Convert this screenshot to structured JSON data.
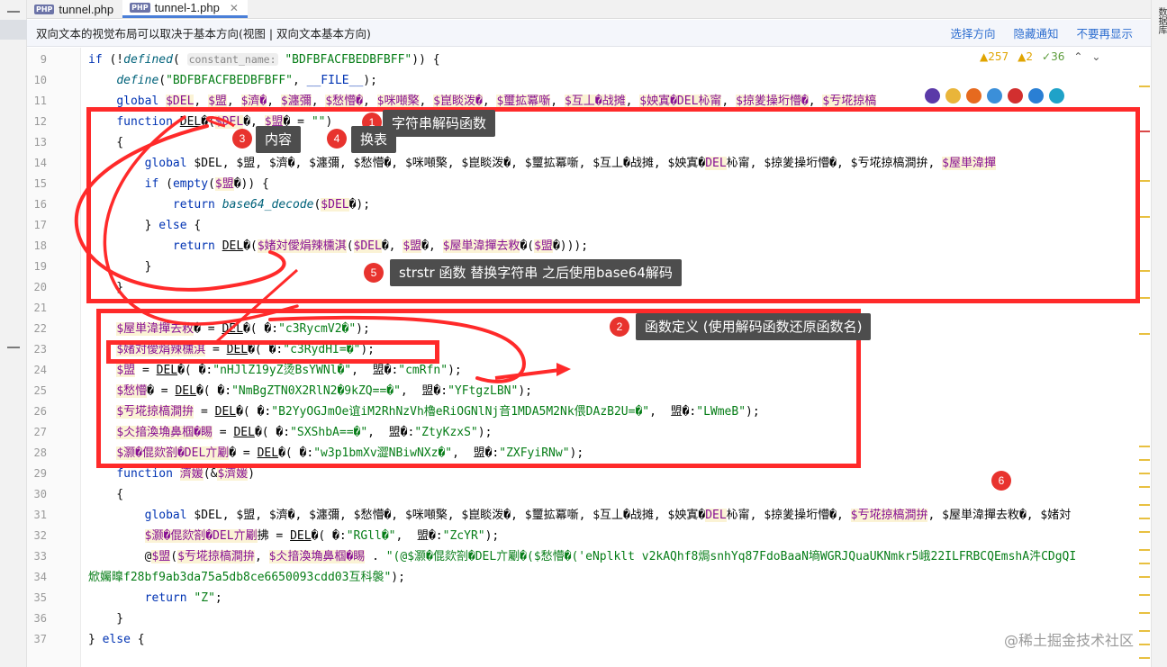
{
  "tabs": [
    {
      "label": "tunnel.php",
      "active": false,
      "icon": "php-file-icon"
    },
    {
      "label": "tunnel-1.php",
      "active": true,
      "icon": "php-file-icon"
    }
  ],
  "banner": {
    "message": "双向文本的视觉布局可以取决于基本方向(视图 | 双向文本基本方向)",
    "actions": [
      "选择方向",
      "隐藏通知",
      "不要再显示"
    ]
  },
  "right_tool": "数据库",
  "inspections": {
    "warnings": "▲257",
    "weak": "▲2",
    "ok": "✓36"
  },
  "code_lines": [
    {
      "n": "9",
      "html": "<span class=\"kw\">if</span> (!<span class=\"fn\">defined</span>( <span class=\"hint\">constant_name:</span> <span class=\"st\">\"BDFBFACFBEDBFBFF\"</span>)) {"
    },
    {
      "n": "10",
      "html": "    <span class=\"fn\">define</span>(<span class=\"st\">\"BDFBFACFBEDBFBFF\"</span>, <span class=\"kw\">__FILE__</span>);"
    },
    {
      "n": "11",
      "html": "    <span class=\"kw\">global</span> <span class=\"var\">$DEL</span>, <span class=\"var\">$盟</span>, <span class=\"var\">$濟�</span>, <span class=\"var\">$瀍彌</span>, <span class=\"var\">$愁懵�</span>, <span class=\"var\">$咪噸檠</span>, <span class=\"var\">$崑睒泼�</span>, <span class=\"var\">$璽拡冪噺</span>, <span class=\"var\">$互丄�战摊</span>, <span class=\"var\">$姎寘�DEL杺甯</span>, <span class=\"var\">$掠夎操垳懵�</span>, <span class=\"var\">$亐埖掠槁</span>"
    },
    {
      "n": "12",
      "html": "    <span class=\"kw\">function</span> <span class=\"ul\">DEL</span>�(<span class=\"var\">$DEL</span>�, <span class=\"var\">$盟</span>� = <span class=\"st\">\"\"</span>)"
    },
    {
      "n": "13",
      "html": "    {"
    },
    {
      "n": "14",
      "html": "        <span class=\"kw\">global</span> $DEL, $盟, $濟�, $瀍彌, $愁懵�, $咪噸檠, $崑睒泼�, $璽拡冪噺, $互丄�战摊, $姎寘�<span class=\"var\">DEL</span>杺甯, $掠夎操垳懵�, $亐埖掠槁澗拚, <span class=\"var\">$屋単湋撣</span>"
    },
    {
      "n": "15",
      "html": "        <span class=\"kw\">if</span> (<span class=\"kw\">empty</span>(<span class=\"var\">$盟</span>�)) {"
    },
    {
      "n": "16",
      "html": "            <span class=\"kw\">return</span> <span class=\"fn\">base64_decode</span>(<span class=\"var\">$DEL</span>�);"
    },
    {
      "n": "17",
      "html": "        } <span class=\"kw\">else</span> {"
    },
    {
      "n": "18",
      "html": "            <span class=\"kw\">return</span> <span class=\"ul\">DEL</span>�(<span class=\"var\">$媎対僾焆辣櫄淇</span>(<span class=\"var\">$DEL</span>�, <span class=\"var\">$盟</span>�, <span class=\"var\">$屋単湋撣去敉</span>�(<span class=\"var\">$盟</span>�)));"
    },
    {
      "n": "19",
      "html": "        }"
    },
    {
      "n": "20",
      "html": "    }"
    },
    {
      "n": "21",
      "html": ""
    },
    {
      "n": "22",
      "html": "    <span class=\"var\">$屋単湋撣去敉</span>� = <span class=\"ul\">DEL</span>�( �:<span class=\"st\">\"c3RycmV2�\"</span>);"
    },
    {
      "n": "23",
      "html": "    <span class=\"var\">$媎対僾焆辣櫄淇</span> = <span class=\"ul\">DEL</span>�( �:<span class=\"st\">\"c3RydHI=�\"</span>);"
    },
    {
      "n": "24",
      "html": "    <span class=\"var\">$盟</span> = <span class=\"ul\">DEL</span>�( �:<span class=\"st\">\"nHJlZ19yZ烫BsYWNl�\"</span>,  盟�:<span class=\"st\">\"cmRfn\"</span>);"
    },
    {
      "n": "25",
      "html": "    <span class=\"var\">$愁懵</span>� = <span class=\"ul\">DEL</span>�( �:<span class=\"st\">\"NmBgZTN0X2RlN2�9kZQ==�\"</span>,  盟�:<span class=\"st\">\"YFtgzLBN\"</span>);"
    },
    {
      "n": "26",
      "html": "    <span class=\"var\">$亐埖掠槁澗拚</span> = <span class=\"ul\">DEL</span>�( �:<span class=\"st\">\"B2YyOGJmOe谊iM2RhNzVh櫓eRiOGNlNj音1MDA5M2Nk偎DAzB2U=�\"</span>,  盟�:<span class=\"st\">\"LWmeB\"</span>);"
    },
    {
      "n": "27",
      "html": "    <span class=\"var\">$仌揞渙埆鼻椢�睗</span> = <span class=\"ul\">DEL</span>�( �:<span class=\"st\">\"SXShbA==�\"</span>,  盟�:<span class=\"st\">\"ZtyKzxS\"</span>);"
    },
    {
      "n": "28",
      "html": "    <span class=\"var\">$灏�倱欻劄�DEL亣劚</span>� = <span class=\"ul\">DEL</span>�( �:<span class=\"st\">\"w3p1bmXv澀NBiwNXz�\"</span>,  盟�:<span class=\"st\">\"ZXFyiRNw\"</span>);"
    },
    {
      "n": "29",
      "html": "    <span class=\"kw\">function</span> <span class=\"var\">濟媛</span>(&amp;<span class=\"var\">$濟媛</span>)"
    },
    {
      "n": "30",
      "html": "    {"
    },
    {
      "n": "31",
      "html": "        <span class=\"kw\">global</span> $DEL, $盟, $濟�, $瀍彌, $愁懵�, $咪噸檠, $崑睒泼�, $璽拡冪噺, $互丄�战摊, $姎寘�<span class=\"var\">DEL</span>杺甯, $掠夎操垳懵�, <span class=\"var\">$亐埖掠槁澗拚</span>, $屋単湋撣去敉�, $媎対"
    },
    {
      "n": "32",
      "html": "        <span class=\"var\">$灏�倱欻劄�DEL亣劚</span>拂 = <span class=\"ul\">DEL</span>�( �:<span class=\"st\">\"RGll�\"</span>,  盟�:<span class=\"st\">\"ZcYR\"</span>);"
    },
    {
      "n": "33",
      "html": "        @<span class=\"var\">$盟</span>(<span class=\"var\">$亐埖掠槁澗拚</span>, <span class=\"var\">$仌揞渙埆鼻椢�睗</span> . <span class=\"st\">\"(@$灏�倱欻劄�DEL亣劚�($愁懵�('eNplklt v2kAQhf8焗snhYq87FdoBaaN墒WGRJQuaUKNmkr5峨22ILFRBCQEmshA汼CDgQI</span>"
    },
    {
      "n": "34",
      "html": "<span class=\"st\">焮孎曍f28bf9ab3da75a5db8ce6650093cdd03互科褩\"</span>);"
    },
    {
      "n": "35",
      "html": "        <span class=\"kw\">return</span> <span class=\"st\">\"Z\"</span>;"
    },
    {
      "n": "36",
      "html": "    }"
    },
    {
      "n": "37",
      "html": "} <span class=\"kw\">else</span> {"
    }
  ],
  "annotations": [
    {
      "num": "1",
      "text": "字符串解码函数"
    },
    {
      "num": "2",
      "text": "函数定义 (使用解码函数还原函数名)"
    },
    {
      "num": "3",
      "text": "内容"
    },
    {
      "num": "4",
      "text": "换表"
    },
    {
      "num": "5",
      "text": "strstr 函数 替换字符串 之后使用base64解码"
    },
    {
      "num": "6",
      "text": ""
    }
  ],
  "watermark": "@稀土掘金技术社区",
  "colors": {
    "annotation_red": "#ff2a2a",
    "callout_bg": "#4d4d4d",
    "keyword": "#0033b3",
    "string": "#067d17"
  }
}
